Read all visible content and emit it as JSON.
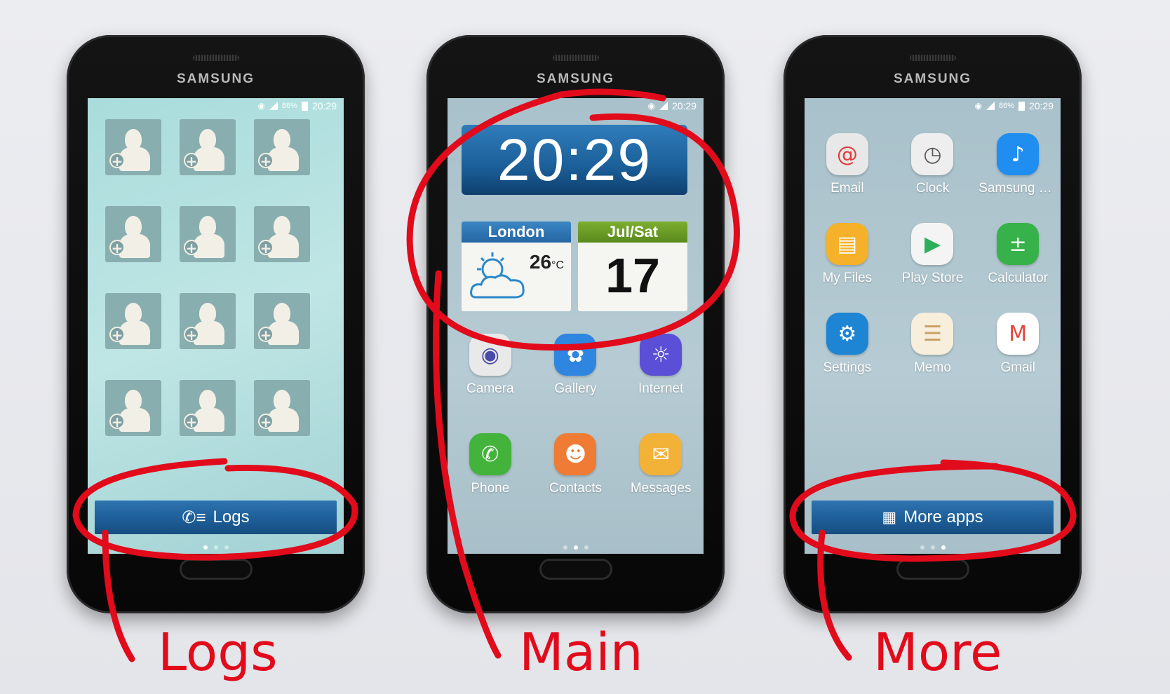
{
  "brand": "SAMSUNG",
  "status": {
    "signal_pct": "86%",
    "time": "20:29"
  },
  "logs_screen": {
    "contact_tiles": 12,
    "button_label": "Logs",
    "button_icon": "call-log-icon",
    "pages": [
      true,
      false,
      false
    ]
  },
  "main_screen": {
    "clock": "20:29",
    "weather": {
      "city": "London",
      "temp": "26",
      "unit": "°C",
      "icon": "partly-cloudy-icon"
    },
    "calendar": {
      "header": "Jul/Sat",
      "day": "17"
    },
    "apps": [
      {
        "label": "Camera",
        "icon": "camera-icon",
        "color": "#e9e9e9"
      },
      {
        "label": "Gallery",
        "icon": "gallery-icon",
        "color": "#2f86e0"
      },
      {
        "label": "Internet",
        "icon": "internet-icon",
        "color": "#5a4fd6"
      },
      {
        "label": "Phone",
        "icon": "phone-icon",
        "color": "#43b33b"
      },
      {
        "label": "Contacts",
        "icon": "contacts-icon",
        "color": "#f07b34"
      },
      {
        "label": "Messages",
        "icon": "messages-icon",
        "color": "#f2b237"
      }
    ],
    "pages": [
      false,
      true,
      false
    ]
  },
  "more_screen": {
    "apps": [
      {
        "label": "Email",
        "icon": "email-icon",
        "color": "#e8e8e8"
      },
      {
        "label": "Clock",
        "icon": "clock-icon",
        "color": "#eeeeee"
      },
      {
        "label": "Samsung M...",
        "icon": "music-icon",
        "color": "#1f8ef0"
      },
      {
        "label": "My Files",
        "icon": "folder-icon",
        "color": "#f5b12a"
      },
      {
        "label": "Play Store",
        "icon": "play-store-icon",
        "color": "#f4f4f4"
      },
      {
        "label": "Calculator",
        "icon": "calculator-icon",
        "color": "#37b24a"
      },
      {
        "label": "Settings",
        "icon": "settings-icon",
        "color": "#1d85d4"
      },
      {
        "label": "Memo",
        "icon": "memo-icon",
        "color": "#f7eedc"
      },
      {
        "label": "Gmail",
        "icon": "gmail-icon",
        "color": "#ffffff"
      }
    ],
    "button_label": "More apps",
    "button_icon": "grid-icon",
    "pages": [
      false,
      false,
      true
    ]
  },
  "captions": {
    "left": "Logs",
    "center": "Main",
    "right": "More"
  },
  "annotation_color": "#e10b1b"
}
